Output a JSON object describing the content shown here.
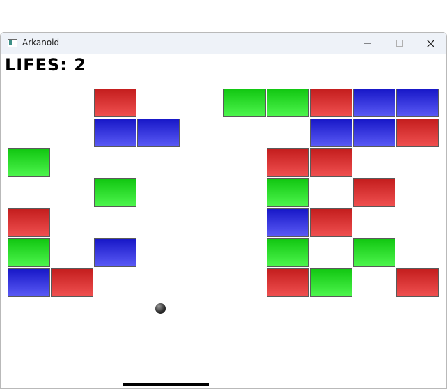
{
  "window": {
    "title": "Arkanoid",
    "icon": "app-window-icon",
    "controls": [
      "minimize-icon",
      "maximize-icon",
      "close-icon"
    ]
  },
  "hud": {
    "lives_text": "LIFES: 2",
    "lives": 2
  },
  "colors": {
    "red": "#e23a3a",
    "green": "#2ee02e",
    "blue": "#3030e0",
    "ball": "#333333",
    "paddle": "#000000"
  },
  "grid": {
    "columns": 10,
    "rows": 7
  },
  "bricks": [
    {
      "row": 0,
      "col": 2,
      "color": "red"
    },
    {
      "row": 0,
      "col": 5,
      "color": "green"
    },
    {
      "row": 0,
      "col": 6,
      "color": "green"
    },
    {
      "row": 0,
      "col": 7,
      "color": "red"
    },
    {
      "row": 0,
      "col": 8,
      "color": "blue"
    },
    {
      "row": 0,
      "col": 9,
      "color": "blue"
    },
    {
      "row": 1,
      "col": 2,
      "color": "blue"
    },
    {
      "row": 1,
      "col": 3,
      "color": "blue"
    },
    {
      "row": 1,
      "col": 7,
      "color": "blue"
    },
    {
      "row": 1,
      "col": 8,
      "color": "blue"
    },
    {
      "row": 1,
      "col": 9,
      "color": "red"
    },
    {
      "row": 2,
      "col": 0,
      "color": "green"
    },
    {
      "row": 2,
      "col": 6,
      "color": "red"
    },
    {
      "row": 2,
      "col": 7,
      "color": "red"
    },
    {
      "row": 3,
      "col": 2,
      "color": "green"
    },
    {
      "row": 3,
      "col": 6,
      "color": "green"
    },
    {
      "row": 3,
      "col": 8,
      "color": "red"
    },
    {
      "row": 4,
      "col": 0,
      "color": "red"
    },
    {
      "row": 4,
      "col": 6,
      "color": "blue"
    },
    {
      "row": 4,
      "col": 7,
      "color": "red"
    },
    {
      "row": 5,
      "col": 0,
      "color": "green"
    },
    {
      "row": 5,
      "col": 2,
      "color": "blue"
    },
    {
      "row": 5,
      "col": 6,
      "color": "green"
    },
    {
      "row": 5,
      "col": 8,
      "color": "green"
    },
    {
      "row": 6,
      "col": 0,
      "color": "blue"
    },
    {
      "row": 6,
      "col": 1,
      "color": "red"
    },
    {
      "row": 6,
      "col": 6,
      "color": "red"
    },
    {
      "row": 6,
      "col": 7,
      "color": "green"
    },
    {
      "row": 6,
      "col": 9,
      "color": "red"
    }
  ]
}
